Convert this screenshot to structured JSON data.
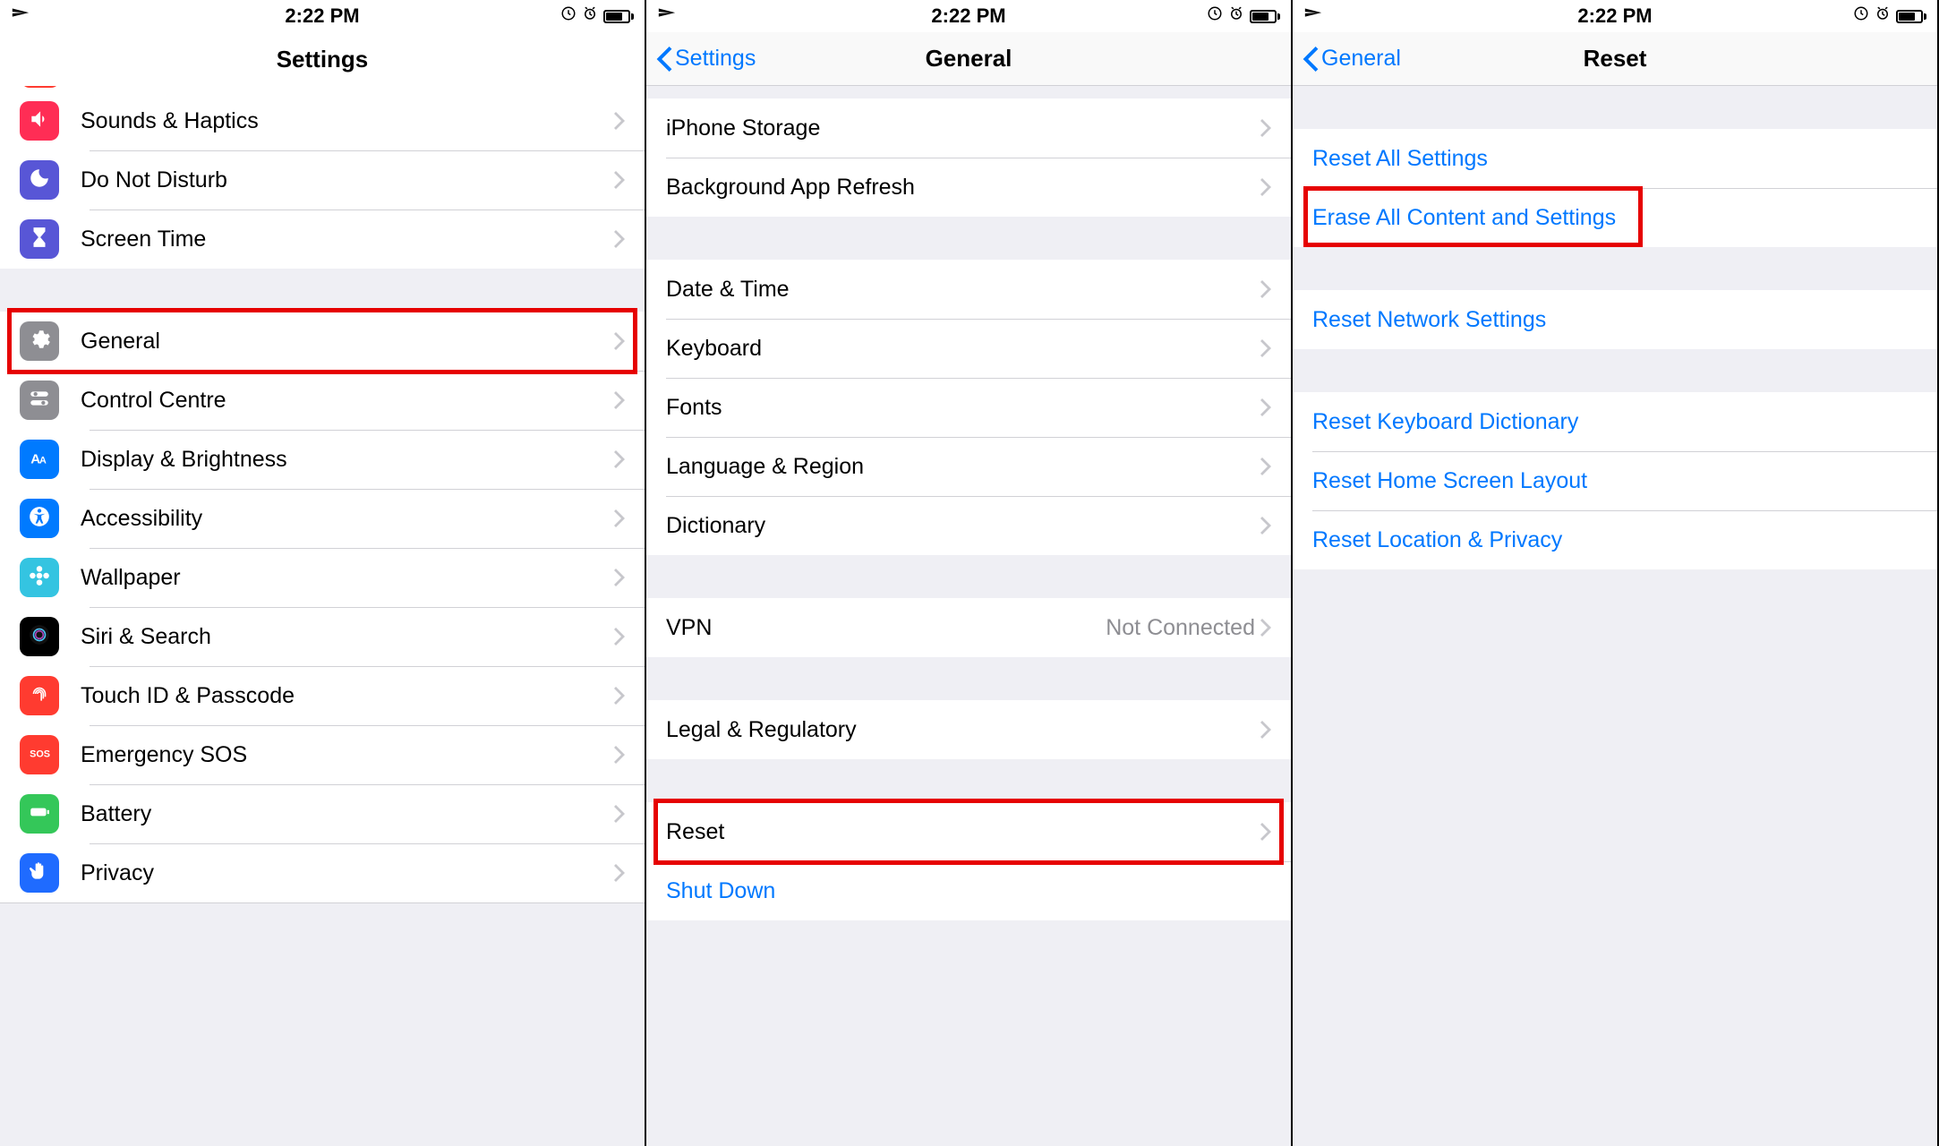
{
  "status": {
    "time": "2:22 PM"
  },
  "pane1": {
    "title": "Settings",
    "stub_icon_bg": "bg-red",
    "groups": [
      [
        {
          "label": "Sounds & Haptics",
          "icon": "sound-icon",
          "icon_bg": "bg-pink"
        },
        {
          "label": "Do Not Disturb",
          "icon": "moon-icon",
          "icon_bg": "bg-purple"
        },
        {
          "label": "Screen Time",
          "icon": "hourglass-icon",
          "icon_bg": "bg-purple"
        }
      ],
      [
        {
          "label": "General",
          "icon": "gear-icon",
          "icon_bg": "bg-gray",
          "highlight": true
        },
        {
          "label": "Control Centre",
          "icon": "switches-icon",
          "icon_bg": "bg-gray"
        },
        {
          "label": "Display & Brightness",
          "icon": "text-size-icon",
          "icon_bg": "bg-blue"
        },
        {
          "label": "Accessibility",
          "icon": "accessibility-icon",
          "icon_bg": "bg-blue"
        },
        {
          "label": "Wallpaper",
          "icon": "flower-icon",
          "icon_bg": "bg-teal"
        },
        {
          "label": "Siri & Search",
          "icon": "siri-icon",
          "icon_bg": "bg-black"
        },
        {
          "label": "Touch ID & Passcode",
          "icon": "fingerprint-icon",
          "icon_bg": "bg-red"
        },
        {
          "label": "Emergency SOS",
          "icon": "sos-icon",
          "icon_bg": "bg-red"
        },
        {
          "label": "Battery",
          "icon": "battery-icon",
          "icon_bg": "bg-green"
        },
        {
          "label": "Privacy",
          "icon": "hand-icon",
          "icon_bg": "bg-darkblue"
        }
      ]
    ]
  },
  "pane2": {
    "back": "Settings",
    "title": "General",
    "groups": [
      [
        {
          "label": "iPhone Storage"
        },
        {
          "label": "Background App Refresh"
        }
      ],
      [
        {
          "label": "Date & Time"
        },
        {
          "label": "Keyboard"
        },
        {
          "label": "Fonts"
        },
        {
          "label": "Language & Region"
        },
        {
          "label": "Dictionary"
        }
      ],
      [
        {
          "label": "VPN",
          "detail": "Not Connected"
        }
      ],
      [
        {
          "label": "Legal & Regulatory"
        }
      ],
      [
        {
          "label": "Reset",
          "highlight": true
        },
        {
          "label": "Shut Down",
          "link": true,
          "no_chevron": true
        }
      ]
    ]
  },
  "pane3": {
    "back": "General",
    "title": "Reset",
    "groups": [
      [
        {
          "label": "Reset All Settings",
          "link": true,
          "no_chevron": true
        },
        {
          "label": "Erase All Content and Settings",
          "link": true,
          "no_chevron": true,
          "highlight": true,
          "highlight_tight": true
        }
      ],
      [
        {
          "label": "Reset Network Settings",
          "link": true,
          "no_chevron": true
        }
      ],
      [
        {
          "label": "Reset Keyboard Dictionary",
          "link": true,
          "no_chevron": true
        },
        {
          "label": "Reset Home Screen Layout",
          "link": true,
          "no_chevron": true
        },
        {
          "label": "Reset Location & Privacy",
          "link": true,
          "no_chevron": true
        }
      ]
    ]
  }
}
